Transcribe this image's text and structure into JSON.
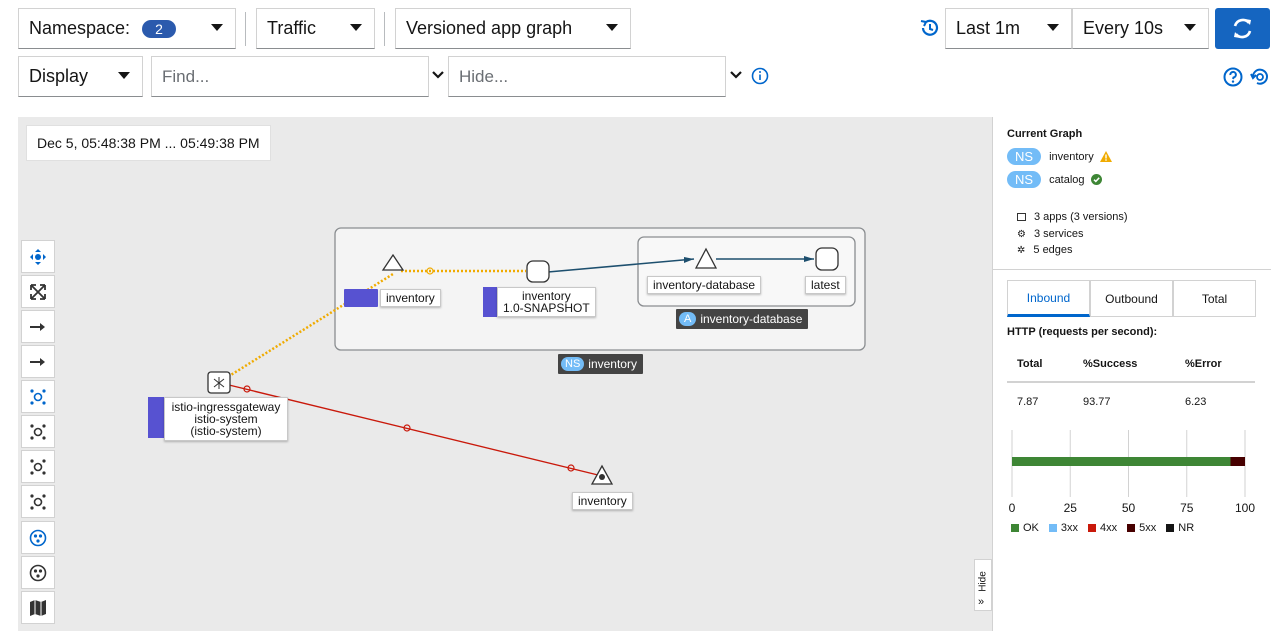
{
  "toolbar": {
    "namespace_label": "Namespace:",
    "namespace_count": "2",
    "traffic_label": "Traffic",
    "graph_type_label": "Versioned app graph",
    "duration_label": "Last 1m",
    "refresh_label": "Every 10s",
    "display_label": "Display",
    "find_placeholder": "Find...",
    "hide_placeholder": "Hide..."
  },
  "graph": {
    "time_range": "Dec 5, 05:48:38 PM ... 05:49:38 PM",
    "nodes": {
      "inventory_app": "inventory",
      "inventory_snapshot_line1": "inventory",
      "inventory_snapshot_line2": "1.0-SNAPSHOT",
      "inventory_database": "inventory-database",
      "latest": "latest",
      "ingress_line1": "istio-ingressgateway",
      "ingress_line2": "istio-system",
      "ingress_line3": "(istio-system)",
      "inventory_service": "inventory"
    },
    "app_box_badge": "A",
    "app_box_label": "inventory-database",
    "ns_box_badge": "NS",
    "ns_box_label": "inventory",
    "hide_panel_label": "Hide",
    "colors": {
      "edge_success": "#f0ab00",
      "edge_error": "#c9190b",
      "edge_tcp": "#1d4f6e",
      "background": "#eaeaea"
    }
  },
  "side_panel": {
    "title": "Current Graph",
    "namespaces": [
      {
        "badge": "NS",
        "name": "inventory",
        "status": "warning"
      },
      {
        "badge": "NS",
        "name": "catalog",
        "status": "ok"
      }
    ],
    "stats": {
      "apps": "3 apps (3 versions)",
      "services": "3 services",
      "edges": "5 edges"
    },
    "tabs": [
      "Inbound",
      "Outbound",
      "Total"
    ],
    "active_tab": "Inbound",
    "http_heading": "HTTP (requests per second):",
    "table_headers": [
      "Total",
      "%Success",
      "%Error"
    ],
    "table_values": [
      "7.87",
      "93.77",
      "6.23"
    ],
    "chart_ticks": [
      "0",
      "25",
      "50",
      "75",
      "100"
    ],
    "legend": [
      {
        "label": "OK",
        "color": "#3e8635"
      },
      {
        "label": "3xx",
        "color": "#73bcf7"
      },
      {
        "label": "4xx",
        "color": "#c9190b"
      },
      {
        "label": "5xx",
        "color": "#470000"
      },
      {
        "label": "NR",
        "color": "#151515"
      }
    ]
  },
  "chart_data": {
    "type": "bar",
    "categories": [
      ""
    ],
    "series": [
      {
        "name": "OK",
        "values": [
          93.77
        ]
      },
      {
        "name": "5xx",
        "values": [
          6.23
        ]
      }
    ],
    "xlim": [
      0,
      100
    ],
    "stacked": true
  }
}
